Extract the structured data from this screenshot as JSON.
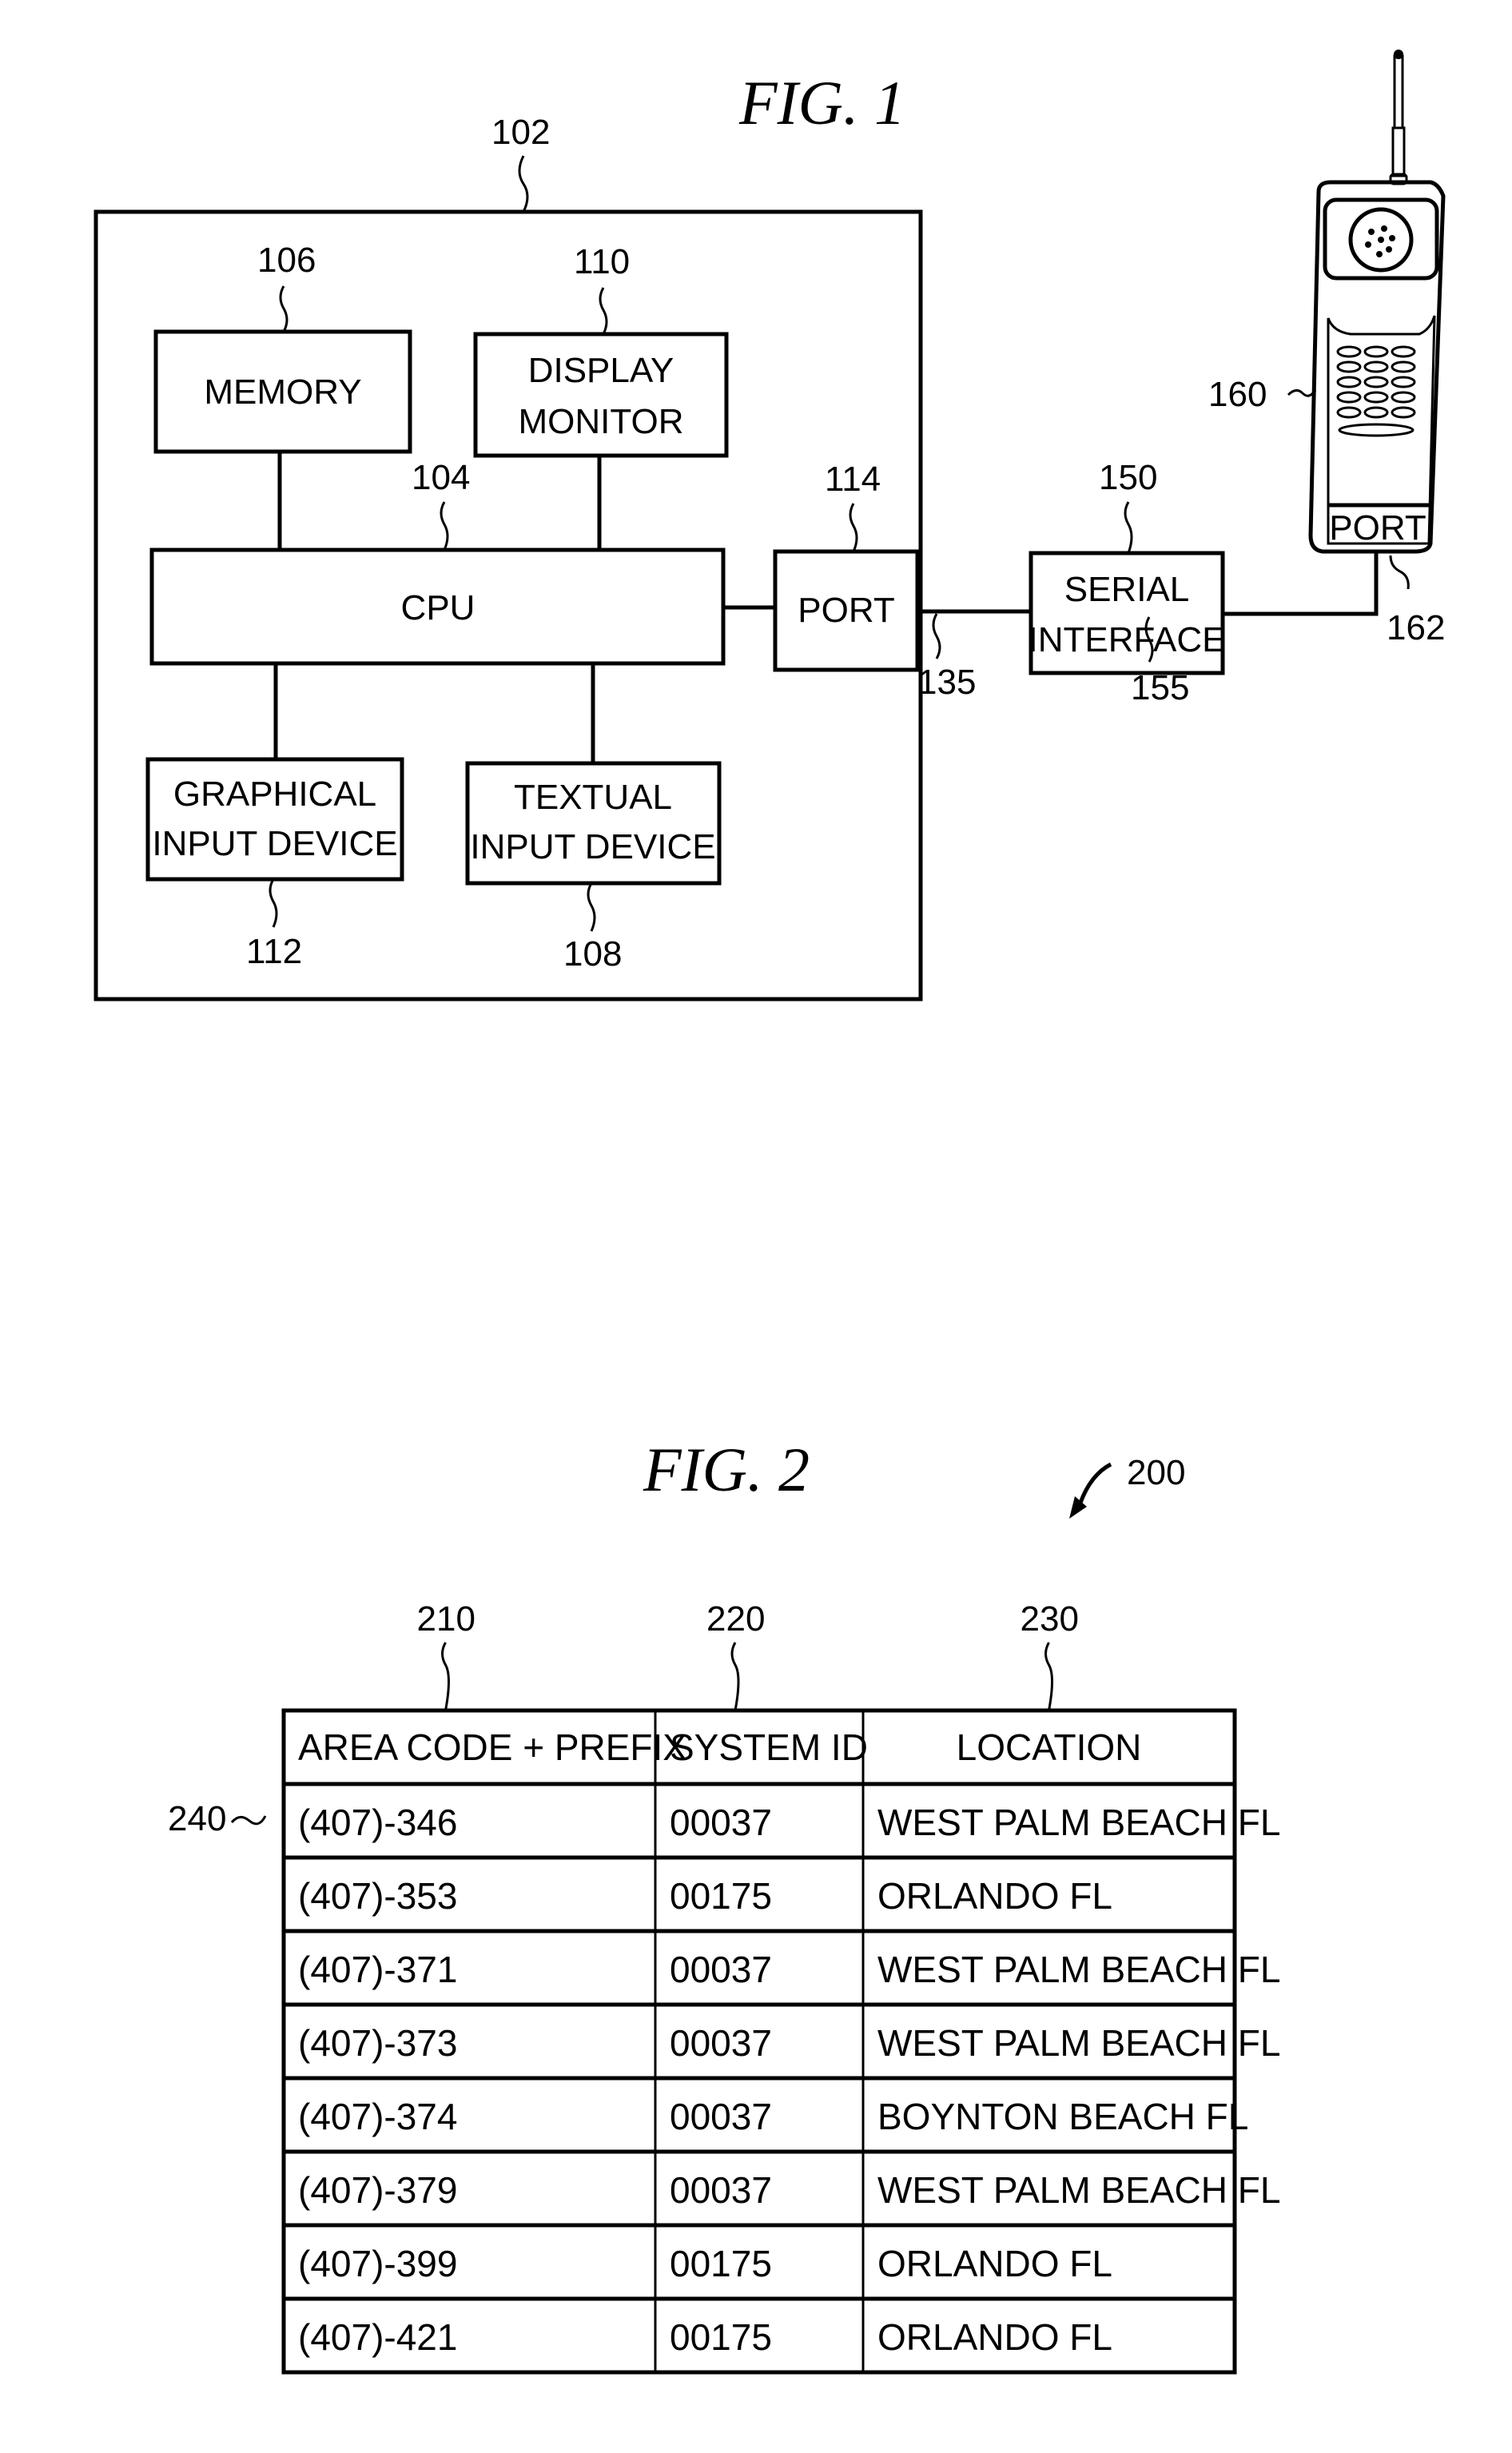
{
  "fig1": {
    "title": "FIG. 1",
    "computer": {
      "ref": "102"
    },
    "memory": {
      "label": "MEMORY",
      "ref": "106"
    },
    "display": {
      "label_line1": "DISPLAY",
      "label_line2": "MONITOR",
      "ref": "110"
    },
    "cpu": {
      "label": "CPU",
      "ref": "104"
    },
    "port": {
      "label": "PORT",
      "ref": "114"
    },
    "graphical_input": {
      "label_line1": "GRAPHICAL",
      "label_line2": "INPUT DEVICE",
      "ref": "112"
    },
    "textual_input": {
      "label_line1": "TEXTUAL",
      "label_line2": "INPUT DEVICE",
      "ref": "108"
    },
    "link_port_serial": {
      "ref": "135"
    },
    "serial_interface": {
      "label_line1": "SERIAL",
      "label_line2": "INTERFACE",
      "ref": "150"
    },
    "link_serial_phone": {
      "ref": "155"
    },
    "phone": {
      "ref": "160",
      "port_label": "PORT",
      "port_ref": "162"
    }
  },
  "fig2": {
    "title": "FIG. 2",
    "table_ref": "200",
    "row_ref": "240",
    "columns": [
      {
        "header": "AREA CODE + PREFIX",
        "ref": "210"
      },
      {
        "header": "SYSTEM ID",
        "ref": "220"
      },
      {
        "header": "LOCATION",
        "ref": "230"
      }
    ],
    "rows": [
      [
        "(407)-346",
        "00037",
        "WEST PALM BEACH FL"
      ],
      [
        "(407)-353",
        "00175",
        "ORLANDO FL"
      ],
      [
        "(407)-371",
        "00037",
        "WEST PALM BEACH FL"
      ],
      [
        "(407)-373",
        "00037",
        "WEST PALM BEACH FL"
      ],
      [
        "(407)-374",
        "00037",
        "BOYNTON BEACH FL"
      ],
      [
        "(407)-379",
        "00037",
        "WEST PALM BEACH FL"
      ],
      [
        "(407)-399",
        "00175",
        "ORLANDO FL"
      ],
      [
        "(407)-421",
        "00175",
        "ORLANDO FL"
      ]
    ]
  }
}
